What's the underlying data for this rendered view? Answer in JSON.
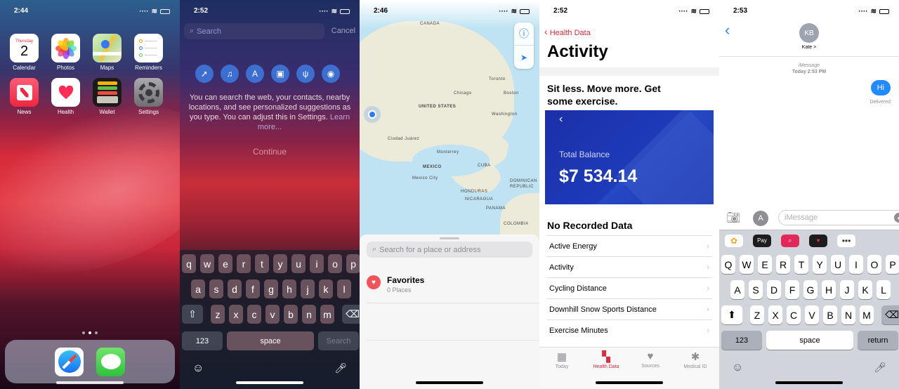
{
  "panel1": {
    "time": "2:44",
    "apps": [
      {
        "label": "Calendar",
        "day": "Thursday",
        "date": "2",
        "color": "#ffffff"
      },
      {
        "label": "Photos",
        "color": "#ffffff"
      },
      {
        "label": "Maps",
        "color": "#cfe9b8"
      },
      {
        "label": "Reminders",
        "color": "#ffffff"
      },
      {
        "label": "News",
        "color": "#f2485a"
      },
      {
        "label": "Health",
        "color": "#ffffff"
      },
      {
        "label": "Wallet",
        "color": "#1a1a1a"
      },
      {
        "label": "Settings",
        "color": "#8e8e93"
      }
    ],
    "dock": [
      "Safari",
      "Messages"
    ]
  },
  "panel2": {
    "time": "2:52",
    "search_placeholder": "Search",
    "cancel": "Cancel",
    "message": "You can search the web, your contacts, nearby locations, and see personalized suggestions as you type. You can adjust this in Settings.",
    "learn_more": "Learn more...",
    "continue": "Continue",
    "keys_row1": [
      "q",
      "w",
      "e",
      "r",
      "t",
      "y",
      "u",
      "i",
      "o",
      "p"
    ],
    "keys_row2": [
      "a",
      "s",
      "d",
      "f",
      "g",
      "h",
      "j",
      "k",
      "l"
    ],
    "keys_row3": [
      "z",
      "x",
      "c",
      "v",
      "b",
      "n",
      "m"
    ],
    "key_123": "123",
    "key_space": "space",
    "key_search": "Search"
  },
  "panel3": {
    "time": "2:46",
    "labels": {
      "canada": "CANADA",
      "us": "UNITED STATES",
      "mexico": "MEXICO",
      "chicago": "Chicago",
      "washington": "Washington",
      "toronto": "Toronto",
      "boston": "Boston",
      "monterrey": "Monterrey",
      "ciudad": "Ciudad Juárez",
      "mexicocity": "Mexico City",
      "honduras": "HONDURAS",
      "nicaragua": "NICARAGUA",
      "panama": "PANAMA",
      "dominican": "DOMINICAN REPUBLIC",
      "colombia": "COLOMBIA",
      "cuba": "CUBA"
    },
    "search_placeholder": "Search for a place or address",
    "favorites_title": "Favorites",
    "favorites_count": "0 Places"
  },
  "panel4": {
    "time": "2:52",
    "back": "Health Data",
    "title": "Activity",
    "headline": "Sit less. Move more. Get some exercise.",
    "banner_label": "Total Balance",
    "banner_value": "$7 534.14",
    "no_data": "No Recorded Data",
    "rows": [
      "Active Energy",
      "Activity",
      "Cycling Distance",
      "Downhill Snow Sports Distance",
      "Exercise Minutes"
    ],
    "tabs": [
      "Today",
      "Health Data",
      "Sources",
      "Medical ID"
    ],
    "accent": "#e4273b"
  },
  "panel5": {
    "time": "2:53",
    "initials": "KB",
    "contact": "Kate >",
    "service": "iMessage",
    "timestamp": "Today 2:53 PM",
    "bubble": "Hi",
    "status": "Delivered",
    "input_placeholder": "iMessage",
    "keys_row1": [
      "Q",
      "W",
      "E",
      "R",
      "T",
      "Y",
      "U",
      "I",
      "O",
      "P"
    ],
    "keys_row2": [
      "A",
      "S",
      "D",
      "F",
      "G",
      "H",
      "J",
      "K",
      "L"
    ],
    "keys_row3": [
      "Z",
      "X",
      "C",
      "V",
      "B",
      "N",
      "M"
    ],
    "key_123": "123",
    "key_space": "space",
    "key_return": "return",
    "accent": "#218afc"
  }
}
